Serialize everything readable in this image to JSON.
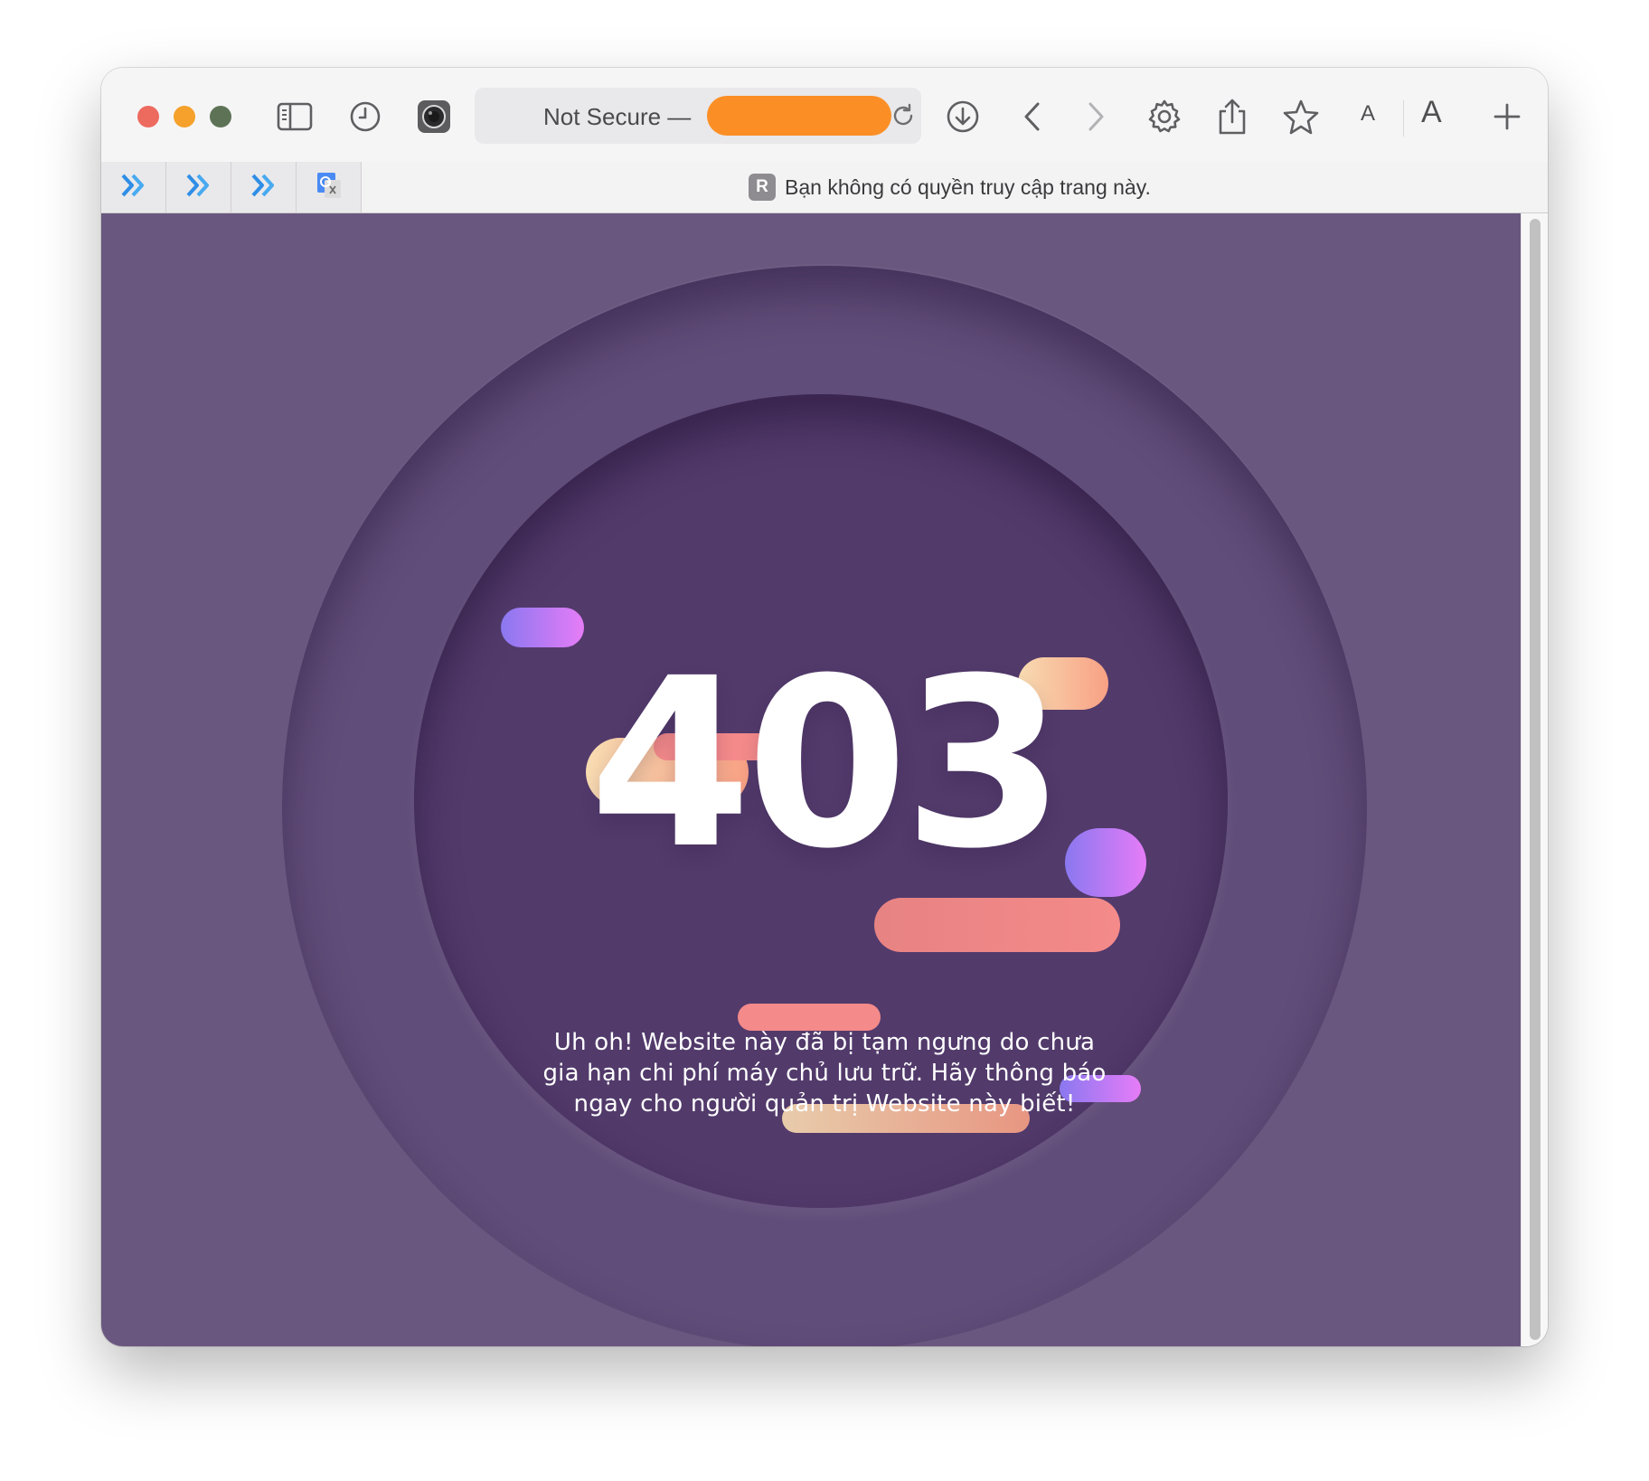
{
  "browser": {
    "address_bar": {
      "security_label": "Not Secure —"
    },
    "toolbar": {
      "font_small_label": "A",
      "font_large_label": "A"
    },
    "pinned_tabs": [
      {
        "icon": "extension-double-chevron-icon"
      },
      {
        "icon": "extension-double-chevron-icon"
      },
      {
        "icon": "extension-double-chevron-icon"
      },
      {
        "icon": "google-translate-icon"
      }
    ],
    "active_tab": {
      "favicon_letter": "R",
      "title": "Bạn không có quyền truy cập trang này."
    }
  },
  "page": {
    "error_code": "403",
    "message": "Uh oh! Website này đã bị tạm ngưng do chưa gia hạn chi phí máy chủ lưu trữ. Hãy thông báo ngay cho người quản trị Website này biết!"
  },
  "colors": {
    "page_background": "#6a577f",
    "outer_ring": "#614d79",
    "inner_circle": "#523a6b",
    "address_redaction": "#fb8f26",
    "pill_violet": "#8a78f0",
    "pill_coral": "#f48a8a",
    "pill_peach": "#f8dcb2"
  }
}
